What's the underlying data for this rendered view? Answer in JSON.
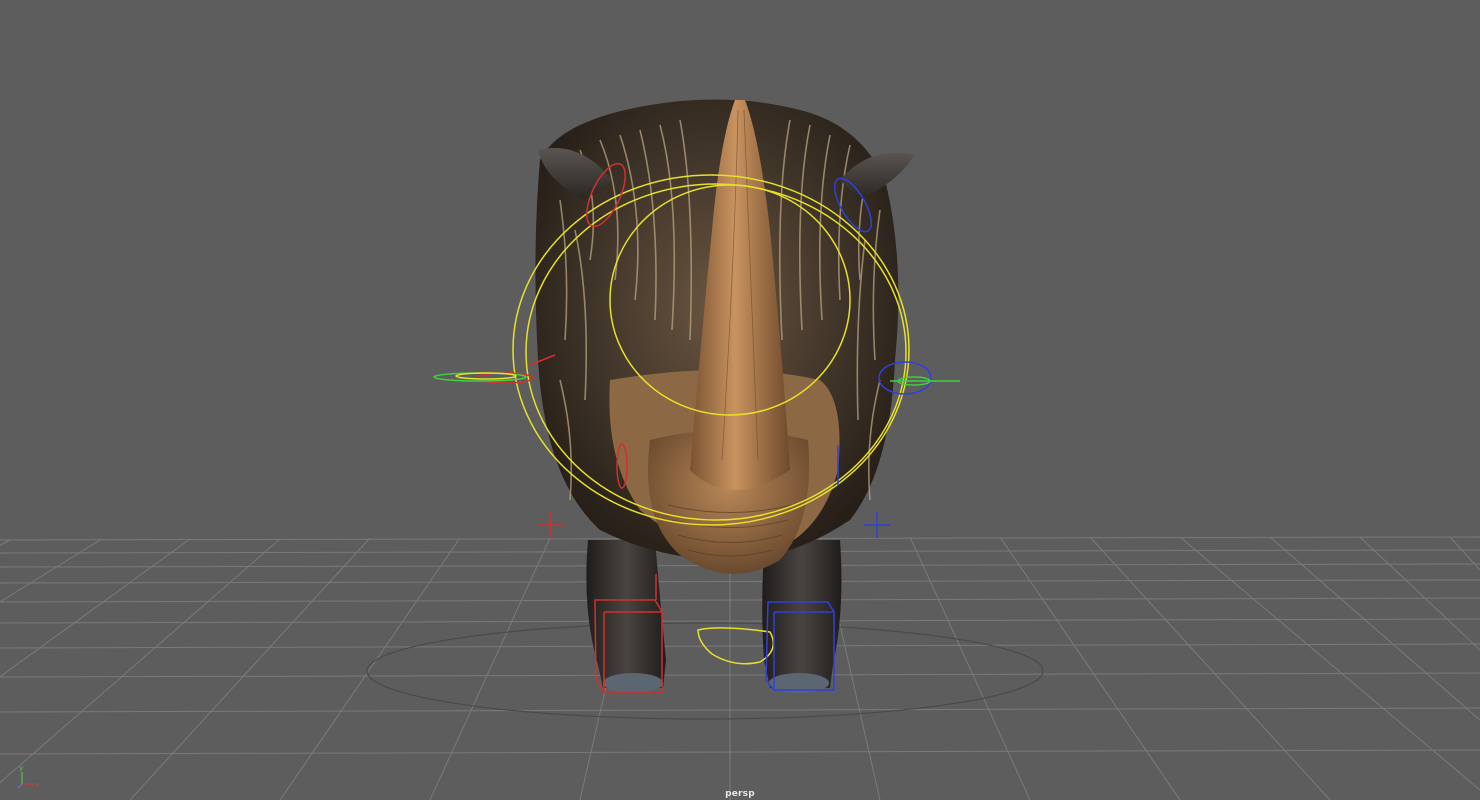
{
  "viewport": {
    "camera_label": "persp",
    "background_color": "#5d5d5d",
    "grid_color": "#7a7a7a"
  },
  "axis_gizmo": {
    "x_label": "x",
    "y_label": "y",
    "x_color": "#d23c3c",
    "y_color": "#58c458",
    "z_color": "#5b7be8"
  },
  "scene": {
    "model": "rhino",
    "controls": [
      {
        "name": "head-control",
        "color": "#e6e02a"
      },
      {
        "name": "neck-control",
        "color": "#e6e02a"
      },
      {
        "name": "jaw-control",
        "color": "#e6e02a"
      },
      {
        "name": "left-side-controls",
        "color": "#d23030"
      },
      {
        "name": "right-side-controls",
        "color": "#3040d8"
      },
      {
        "name": "spine-controls",
        "color": "#3fd13f"
      }
    ]
  }
}
